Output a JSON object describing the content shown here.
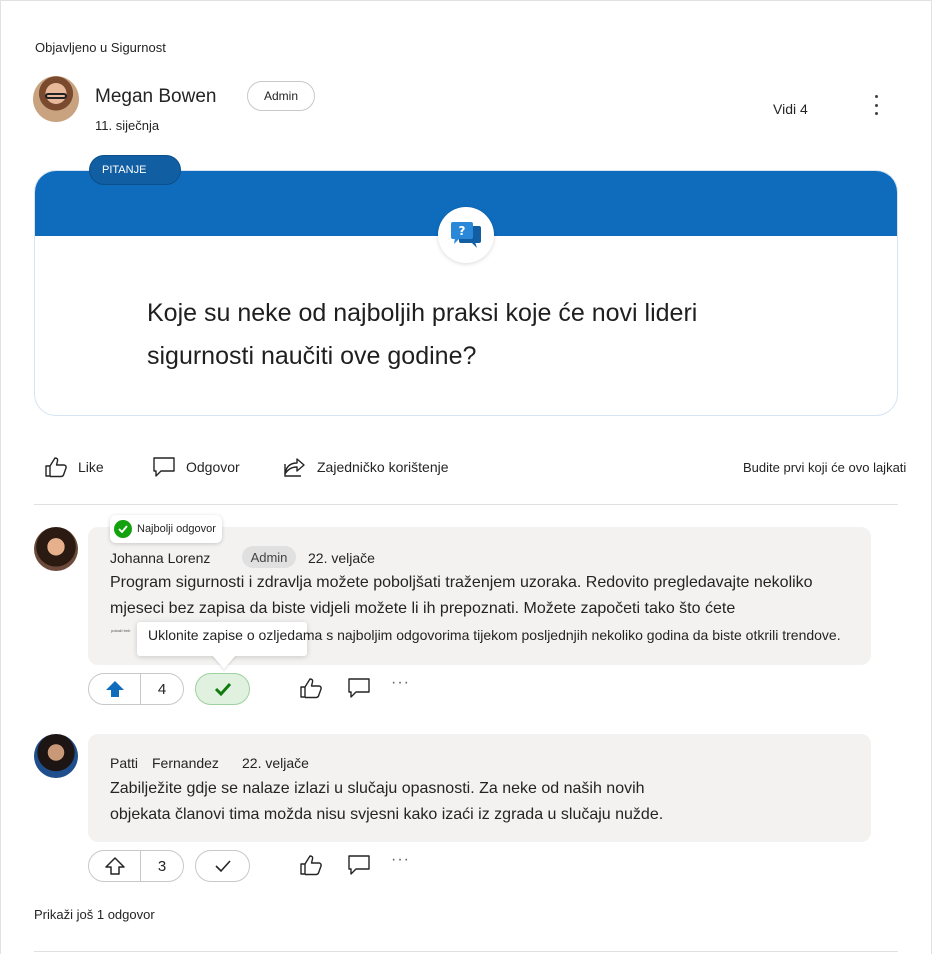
{
  "post": {
    "posted_in": "Objavljeno u Sigurnost",
    "author": "Megan Bowen",
    "author_badge": "Admin",
    "date": "11. siječnja",
    "views": "Vidi 4",
    "tag": "PITANJE",
    "question": "Koje su neke od najboljih praksi koje će novi lideri sigurnosti naučiti ove godine?",
    "actions": {
      "like": "Like",
      "reply": "Odgovor",
      "share": "Zajedničko korištenje"
    },
    "like_prompt": "Budite prvi koji će ovo lajkati",
    "icons": {
      "more": "more-vertical-icon",
      "question": "question-bubble-icon"
    },
    "accent_color": "#0f6cbd"
  },
  "replies": [
    {
      "best_answer_label": "Najbolji odgovor",
      "author": "Johanna Lorenz",
      "badge": "Admin",
      "date": "22. veljače",
      "body_line1": "Program sigurnosti i zdravlja možete poboljšati traženjem uzoraka. Redovito pregledavajte nekoliko",
      "body_line2": "mjeseci bez zapisa da biste vidjeli možete li ih prepoznati. Možete započeti tako što ćete",
      "tiny_text": "pokaži beb",
      "body_line3": "Uklonite zapise o ozljedama s najboljim odgovorima tijekom posljednjih nekoliko godina da biste otkrili trendove.",
      "votes": "4",
      "accepted": true
    },
    {
      "author_first": "Patti",
      "author_last": "Fernandez",
      "date": "22. veljače",
      "body_line1": "Zabilježite gdje se nalaze izlazi u slučaju opasnosti. Za neke od naših novih",
      "body_line2": "objekata članovi tima možda nisu svjesni kako izaći iz zgrada u slučaju nužde.",
      "votes": "3",
      "accepted": false
    }
  ],
  "more_replies": "Prikaži još 1 odgovor",
  "ellipsis": "···"
}
